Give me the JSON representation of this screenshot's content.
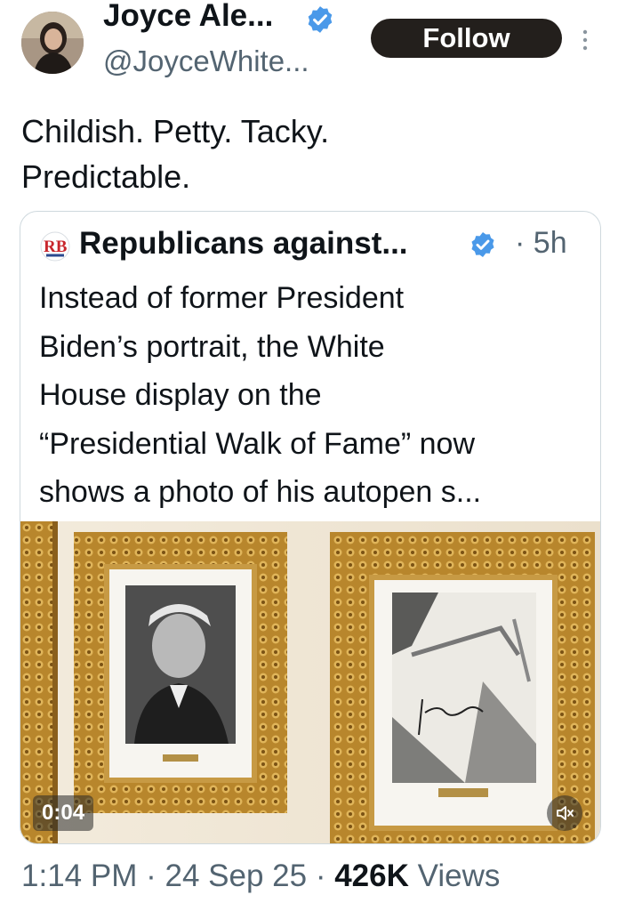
{
  "author": {
    "display_name": "Joyce Ale...",
    "handle": "@JoyceWhite...",
    "verified": true,
    "avatar_icon": "profile-photo"
  },
  "follow_label": "Follow",
  "more_icon": "more-vertical-icon",
  "tweet": {
    "line1": "Childish. Petty. Tacky.",
    "line2": "Predictable."
  },
  "quote": {
    "avatar_icon": "rb-logo",
    "avatar_text": "RB",
    "display_name": "Republicans against...",
    "verified": true,
    "separator": "·",
    "time": "5h",
    "lines": [
      "Instead of former President",
      "Biden’s portrait, the White",
      "House display on the",
      "“Presidential Walk of Fame” now",
      "shows a photo of his autopen s..."
    ],
    "video": {
      "duration": "0:04",
      "mute_icon": "speaker-muted-icon"
    }
  },
  "meta": {
    "time": "1:14 PM",
    "date": "24 Sep 25",
    "views_count": "426K",
    "views_label": "Views",
    "separator": "·"
  },
  "colors": {
    "text_primary": "#0f1419",
    "text_secondary": "#536471",
    "verified_blue": "#4a99e9",
    "follow_bg": "#231f1c",
    "card_border": "#cfd9de",
    "frame_gold": "#b8862c",
    "wall": "#efe6d6"
  }
}
